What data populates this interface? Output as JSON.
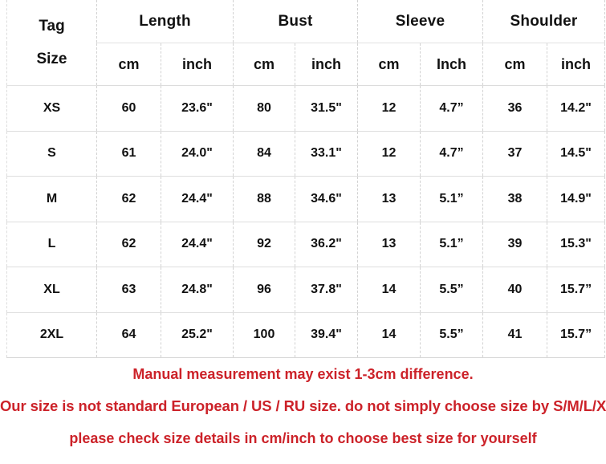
{
  "table": {
    "corner": {
      "tag_label": "Tag",
      "size_label": "Size",
      "color": "#bf2a2e"
    },
    "groups": [
      {
        "name": "Length",
        "cm_label": "cm",
        "inch_label": "inch"
      },
      {
        "name": "Bust",
        "cm_label": "cm",
        "inch_label": "inch"
      },
      {
        "name": "Sleeve",
        "cm_label": "cm",
        "inch_label": "Inch"
      },
      {
        "name": "Shoulder",
        "cm_label": "cm",
        "inch_label": "inch"
      }
    ],
    "rows": [
      {
        "size": "XS",
        "length_cm": "60",
        "length_inch": "23.6\"",
        "bust_cm": "80",
        "bust_inch": "31.5\"",
        "sleeve_cm": "12",
        "sleeve_inch": "4.7”",
        "shoulder_cm": "36",
        "shoulder_inch": "14.2\""
      },
      {
        "size": "S",
        "length_cm": "61",
        "length_inch": "24.0\"",
        "bust_cm": "84",
        "bust_inch": "33.1\"",
        "sleeve_cm": "12",
        "sleeve_inch": "4.7”",
        "shoulder_cm": "37",
        "shoulder_inch": "14.5\""
      },
      {
        "size": "M",
        "length_cm": "62",
        "length_inch": "24.4\"",
        "bust_cm": "88",
        "bust_inch": "34.6\"",
        "sleeve_cm": "13",
        "sleeve_inch": "5.1”",
        "shoulder_cm": "38",
        "shoulder_inch": "14.9\""
      },
      {
        "size": "L",
        "length_cm": "62",
        "length_inch": "24.4\"",
        "bust_cm": "92",
        "bust_inch": "36.2\"",
        "sleeve_cm": "13",
        "sleeve_inch": "5.1”",
        "shoulder_cm": "39",
        "shoulder_inch": "15.3\""
      },
      {
        "size": "XL",
        "length_cm": "63",
        "length_inch": "24.8\"",
        "bust_cm": "96",
        "bust_inch": "37.8\"",
        "sleeve_cm": "14",
        "sleeve_inch": "5.5”",
        "shoulder_cm": "40",
        "shoulder_inch": "15.7”"
      },
      {
        "size": "2XL",
        "length_cm": "64",
        "length_inch": "25.2\"",
        "bust_cm": "100",
        "bust_inch": "39.4\"",
        "sleeve_cm": "14",
        "sleeve_inch": "5.5”",
        "shoulder_cm": "41",
        "shoulder_inch": "15.7”"
      }
    ]
  },
  "notes": {
    "color": "#cc2229",
    "line1": "Manual measurement may exist 1-3cm difference.",
    "line2": "Our size is not standard European / US / RU size. do not simply choose size by S/M/L/XL,",
    "line3": "please check size details in cm/inch to choose best size for yourself"
  }
}
